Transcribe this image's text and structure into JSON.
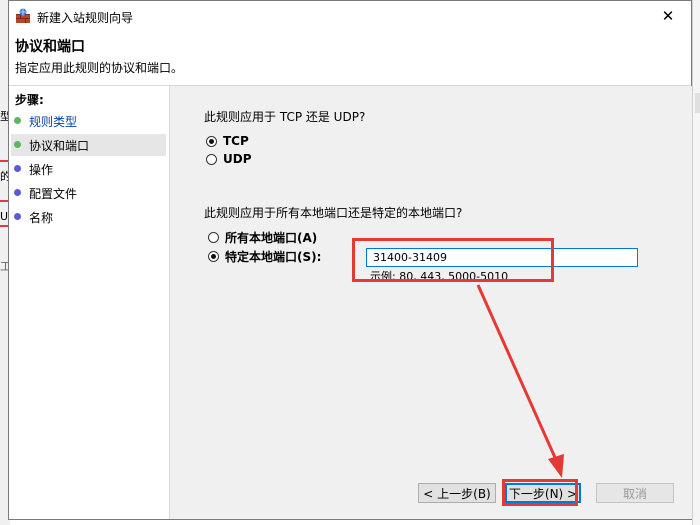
{
  "window": {
    "title": "新建入站规则向导",
    "close_glyph": "✕"
  },
  "header": {
    "title": "协议和端口",
    "description": "指定应用此规则的协议和端口。"
  },
  "steps": {
    "label": "步骤:",
    "items": [
      {
        "label": "规则类型",
        "state": "link",
        "dot_color": "#5cb85c"
      },
      {
        "label": "协议和端口",
        "state": "current",
        "dot_color": "#5cb85c"
      },
      {
        "label": "操作",
        "state": "pending",
        "dot_color": "#5b5bd6"
      },
      {
        "label": "配置文件",
        "state": "pending",
        "dot_color": "#5b5bd6"
      },
      {
        "label": "名称",
        "state": "pending",
        "dot_color": "#5b5bd6"
      }
    ]
  },
  "protocol": {
    "question": "此规则应用于 TCP 还是 UDP?",
    "options": [
      {
        "label": "TCP",
        "selected": true
      },
      {
        "label": "UDP",
        "selected": false
      }
    ]
  },
  "ports": {
    "question": "此规则应用于所有本地端口还是特定的本地端口?",
    "options": [
      {
        "label": "所有本地端口(A)",
        "selected": false
      },
      {
        "label": "特定本地端口(S):",
        "selected": true
      }
    ],
    "value": "31400-31409",
    "example": "示例: 80, 443, 5000-5010"
  },
  "buttons": {
    "back": "< 上一步(B)",
    "next": "下一步(N) >",
    "cancel": "取消"
  },
  "background": {
    "fragments": [
      "型",
      "的",
      "U",
      "工"
    ]
  },
  "colors": {
    "annotation": "#e53935",
    "link": "#0645ad",
    "focus": "#0078d7"
  }
}
